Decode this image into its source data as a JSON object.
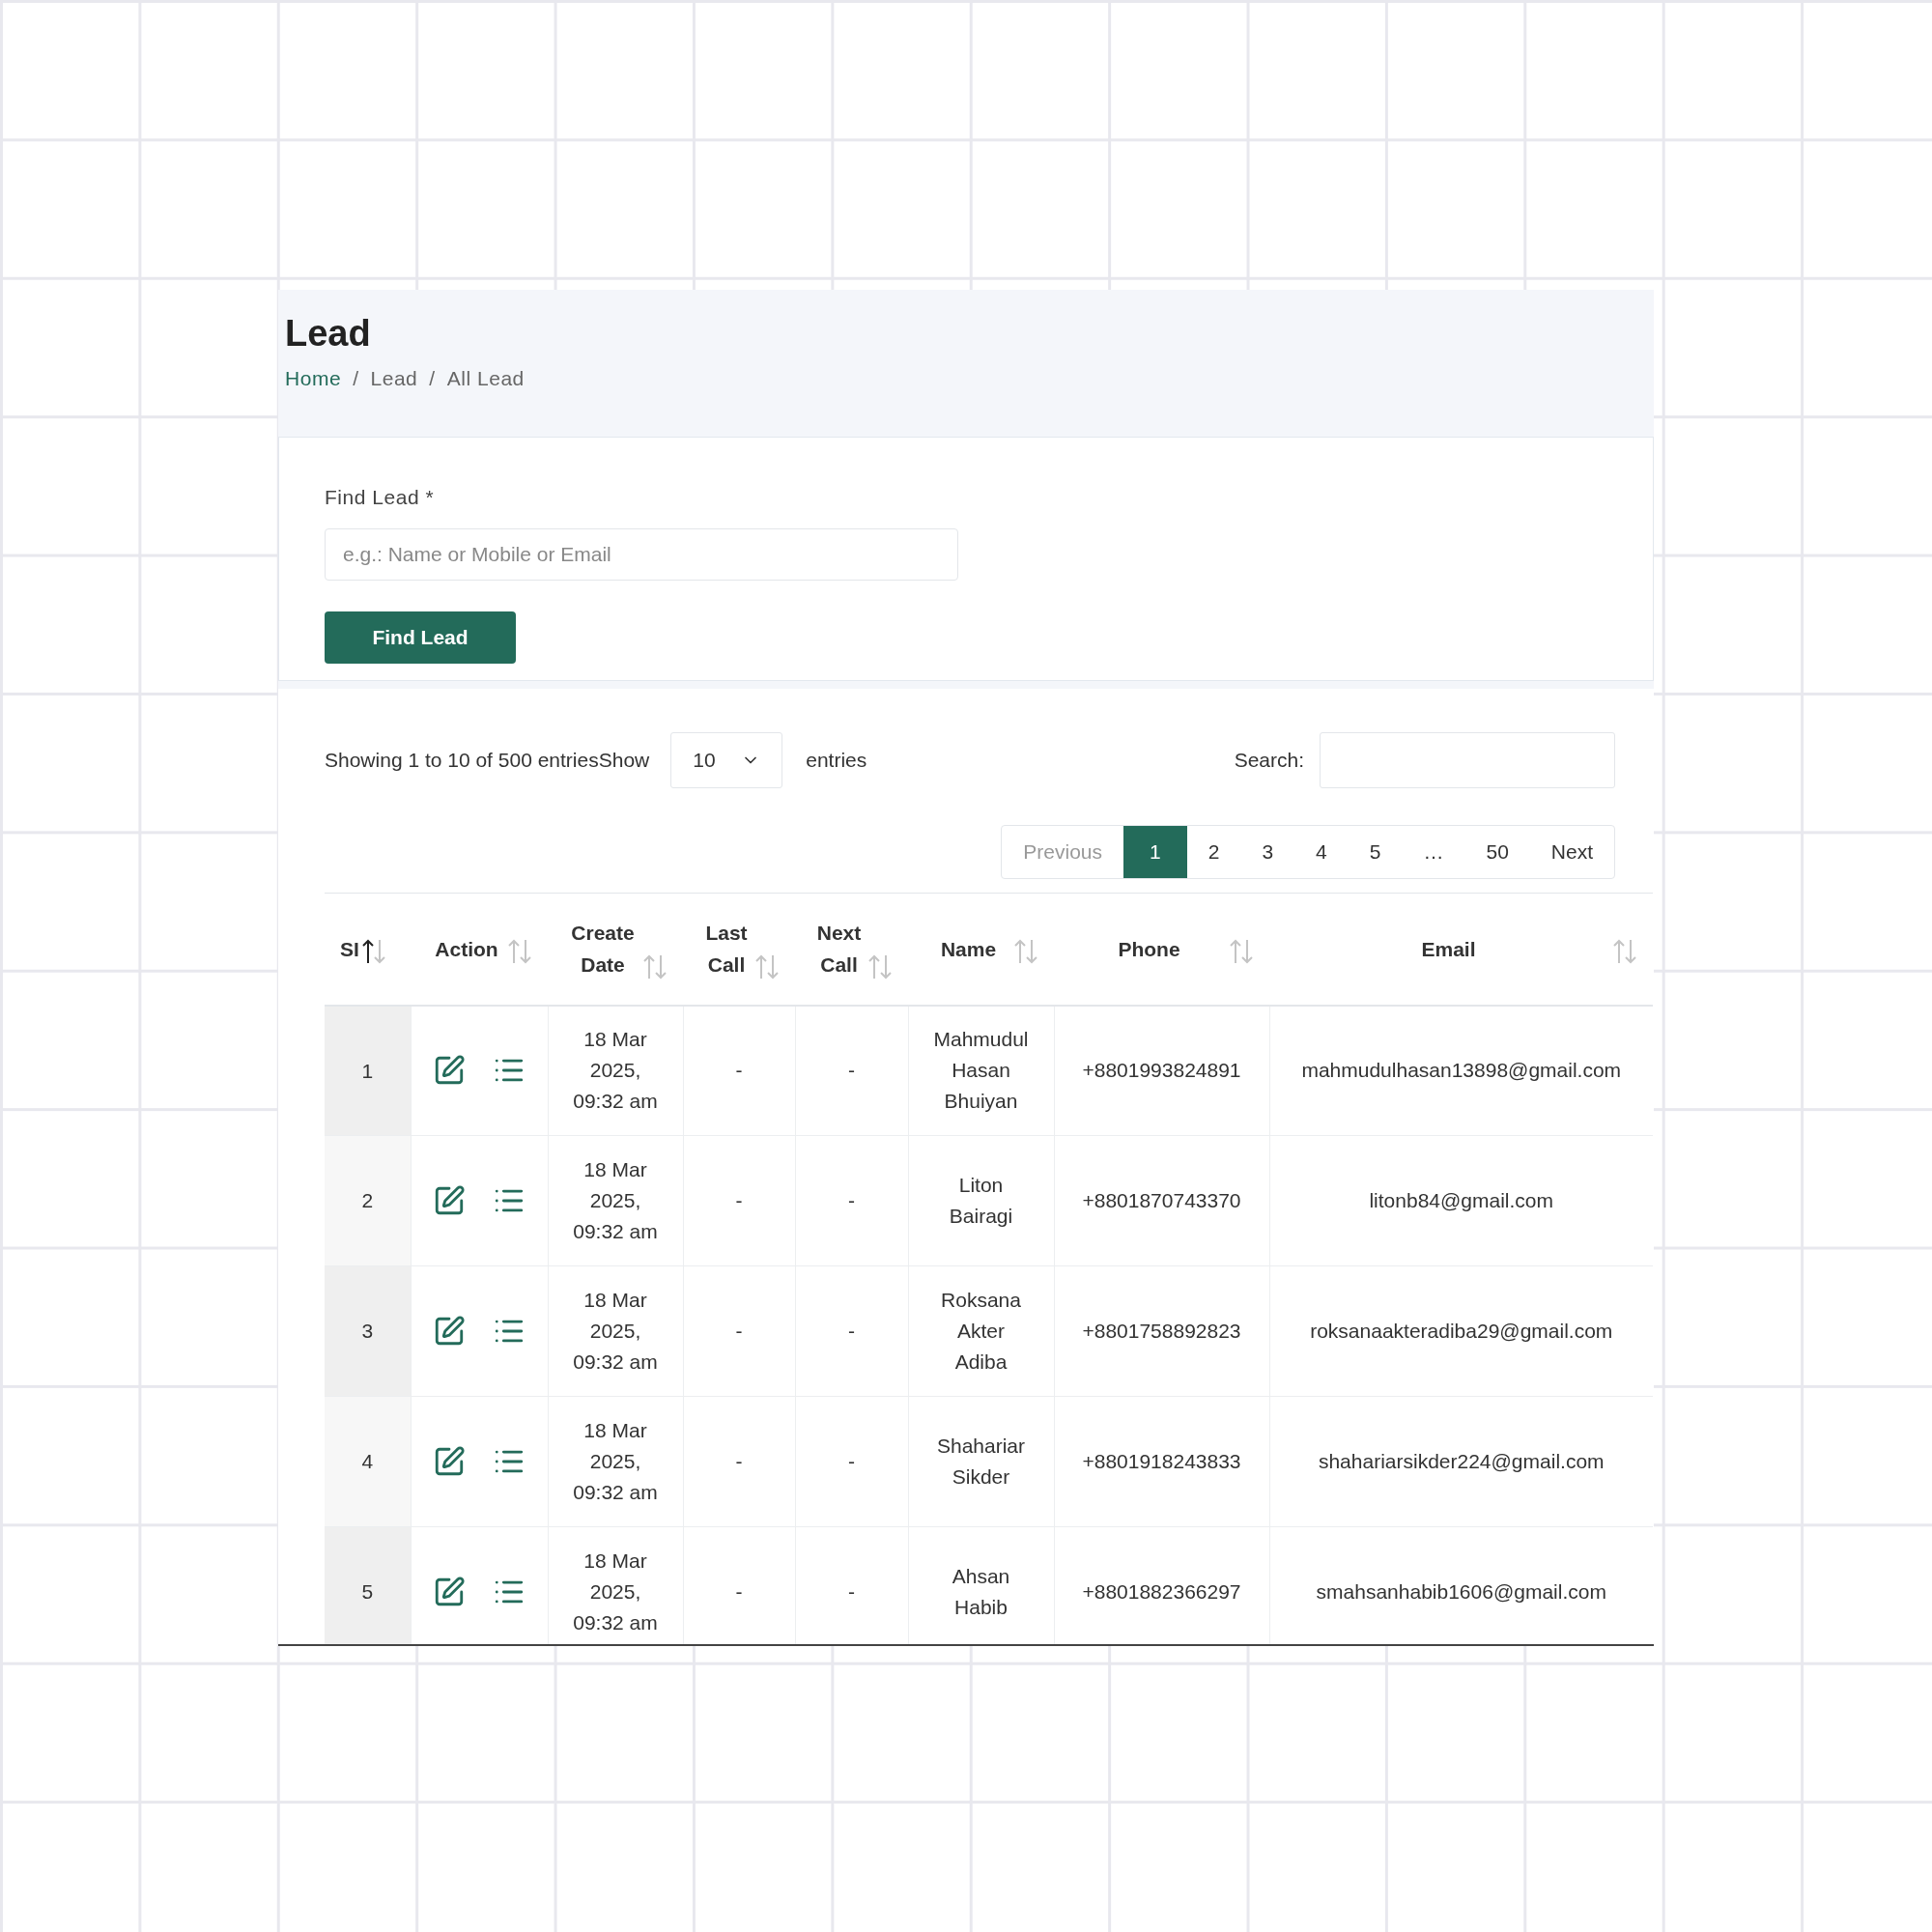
{
  "page": {
    "title": "Lead",
    "breadcrumb": [
      {
        "label": "Home",
        "link": true
      },
      {
        "label": "Lead",
        "link": false
      },
      {
        "label": "All Lead",
        "link": false
      }
    ],
    "separator": "/"
  },
  "form": {
    "label": "Find Lead *",
    "placeholder": "e.g.: Name or Mobile or Email",
    "button": "Find Lead"
  },
  "table_controls": {
    "info": "Showing 1 to 10 of 500 entriesShow",
    "length": "10",
    "length_suffix": "entries",
    "search_label": "Search:"
  },
  "pagination": [
    {
      "label": "Previous",
      "selected": false,
      "disabled": true
    },
    {
      "label": "1",
      "selected": true,
      "disabled": false
    },
    {
      "label": "2",
      "selected": false,
      "disabled": false
    },
    {
      "label": "3",
      "selected": false,
      "disabled": false
    },
    {
      "label": "4",
      "selected": false,
      "disabled": false
    },
    {
      "label": "5",
      "selected": false,
      "disabled": false
    },
    {
      "label": "…",
      "selected": false,
      "disabled": false
    },
    {
      "label": "50",
      "selected": false,
      "disabled": false
    },
    {
      "label": "Next",
      "selected": false,
      "disabled": false
    }
  ],
  "table": {
    "columns": [
      {
        "label": "SI",
        "sorted_ascending": true
      },
      {
        "label": "Action",
        "sorted_ascending": false
      },
      {
        "label": "Create Date",
        "sorted_ascending": false
      },
      {
        "label": "Last Call",
        "sorted_ascending": false
      },
      {
        "label": "Next Call",
        "sorted_ascending": false
      },
      {
        "label": "Name",
        "sorted_ascending": false
      },
      {
        "label": "Phone",
        "sorted_ascending": false
      },
      {
        "label": "Email",
        "sorted_ascending": false
      }
    ],
    "rows": [
      {
        "si": "1",
        "create_date": "18 Mar 2025, 09:32 am",
        "last_call": "-",
        "next_call": "-",
        "name": "Mahmudul Hasan Bhuiyan",
        "phone": "+8801993824891",
        "email": "mahmudulhasan13898@gmail.com"
      },
      {
        "si": "2",
        "create_date": "18 Mar 2025, 09:32 am",
        "last_call": "-",
        "next_call": "-",
        "name": "Liton Bairagi",
        "phone": "+8801870743370",
        "email": "litonb84@gmail.com"
      },
      {
        "si": "3",
        "create_date": "18 Mar 2025, 09:32 am",
        "last_call": "-",
        "next_call": "-",
        "name": "Roksana Akter Adiba",
        "phone": "+8801758892823",
        "email": "roksanaakteradiba29@gmail.com"
      },
      {
        "si": "4",
        "create_date": "18 Mar 2025, 09:32 am",
        "last_call": "-",
        "next_call": "-",
        "name": "Shahariar Sikder",
        "phone": "+8801918243833",
        "email": "shahariarsikder224@gmail.com"
      },
      {
        "si": "5",
        "create_date": "18 Mar 2025, 09:32 am",
        "last_call": "-",
        "next_call": "-",
        "name": "Ahsan Habib",
        "phone": "+8801882366297",
        "email": "smahsanhabib1606@gmail.com"
      }
    ]
  }
}
